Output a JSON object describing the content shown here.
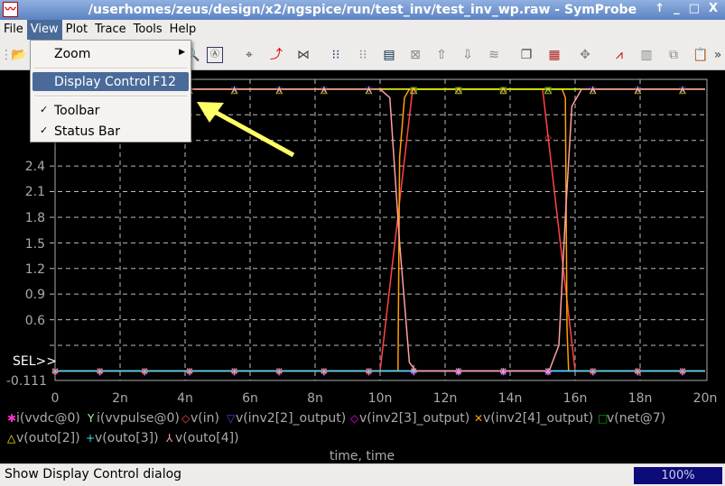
{
  "window": {
    "title": "/userhomes/zeus/design/x2/ngspice/run/test_inv/test_inv_wp.raw - SymProbe",
    "buttons": [
      "↑",
      "_",
      "□",
      "X"
    ]
  },
  "menubar": [
    "File",
    "View",
    "Plot",
    "Trace",
    "Tools",
    "Help"
  ],
  "view_menu": {
    "zoom": "Zoom",
    "display_control": "Display Control",
    "display_control_shortcut": "F12",
    "toolbar": "Toolbar",
    "status_bar": "Status Bar",
    "checked": [
      "Toolbar",
      "Status Bar"
    ]
  },
  "toolbar_icons": [
    "open-folder",
    "zoom",
    "zoom-region",
    "crosshair",
    "curve-cursor",
    "waveform-cross",
    "grid-red",
    "grid-dotted",
    "panel-wave",
    "panel-empty",
    "move-up",
    "move-down",
    "wave-stack",
    "copy-window",
    "inspect-window",
    "pan",
    "line-chart",
    "histogram",
    "copy-plot",
    "paste-plot",
    "more"
  ],
  "status": {
    "text": "Show Display Control dialog",
    "progress": "100%",
    "progress_value": 100
  },
  "annotation": {
    "arrow_color": "#ffff66"
  },
  "chart_data": {
    "type": "line",
    "xlabel": "time, time",
    "xlim": [
      0,
      20
    ],
    "ylim": [
      -0.111,
      3.35
    ],
    "x_ticks": [
      "0",
      "2n",
      "4n",
      "6n",
      "8n",
      "10n",
      "12n",
      "14n",
      "16n",
      "18n",
      "20n"
    ],
    "y_ticks": [
      "2.4",
      "2.1",
      "1.8",
      "1.5",
      "1.2",
      "0.9",
      "0.6",
      "-0.111"
    ],
    "y_tick_values": [
      2.4,
      2.1,
      1.8,
      1.5,
      1.2,
      0.9,
      0.6,
      -0.111
    ],
    "sel_label": "SEL>>",
    "grid": true,
    "legend_placement": "bottom",
    "series": [
      {
        "name": "i(vvdc@0)",
        "color": "#ff33cc",
        "marker": "✱",
        "x": [
          0,
          20
        ],
        "y": [
          0,
          0
        ]
      },
      {
        "name": "i(vvpulse@0)",
        "color": "#a0ffa0",
        "marker": "Y",
        "x": [
          0,
          20
        ],
        "y": [
          0,
          0
        ]
      },
      {
        "name": "v(in)",
        "color": "#ff4444",
        "marker": "◇",
        "x": [
          0,
          10,
          11,
          15,
          16,
          20
        ],
        "y": [
          0,
          0,
          3.3,
          3.3,
          0,
          0
        ]
      },
      {
        "name": "v(inv2[2]_output)",
        "color": "#4444ff",
        "marker": "▽",
        "x": [
          0,
          20
        ],
        "y": [
          3.3,
          3.3
        ]
      },
      {
        "name": "v(inv2[3]_output)",
        "color": "#ff00ff",
        "marker": "◇",
        "x": [
          0,
          20
        ],
        "y": [
          0,
          0
        ]
      },
      {
        "name": "v(inv2[4]_output)",
        "color": "#ffa000",
        "marker": "✕",
        "x": [
          0,
          10.55,
          10.6,
          10.75,
          10.9,
          15.6,
          15.7,
          15.75,
          15.8,
          20
        ],
        "y": [
          0,
          0,
          2.5,
          3.2,
          3.3,
          3.3,
          3.2,
          0.5,
          0,
          0
        ]
      },
      {
        "name": "v(net@7)",
        "color": "#00b000",
        "marker": "□",
        "x": [
          11,
          16
        ],
        "y": [
          3.3,
          3.3
        ]
      },
      {
        "name": "v(outo[2])",
        "color": "#ffff00",
        "marker": "△",
        "x": [
          0,
          20
        ],
        "y": [
          3.3,
          3.3
        ]
      },
      {
        "name": "v(outo[3])",
        "color": "#40e0ff",
        "marker": "+",
        "x": [
          0,
          20
        ],
        "y": [
          0,
          0
        ]
      },
      {
        "name": "v(outo[4])",
        "color": "#ffa0a0",
        "marker": "⅄",
        "x": [
          0,
          10,
          10.3,
          10.6,
          10.9,
          11.1,
          15.2,
          15.5,
          15.7,
          15.9,
          16.2,
          20
        ],
        "y": [
          3.3,
          3.3,
          3.2,
          1.5,
          0.1,
          0,
          0,
          0.3,
          1.8,
          3.1,
          3.3,
          3.3
        ]
      }
    ]
  }
}
